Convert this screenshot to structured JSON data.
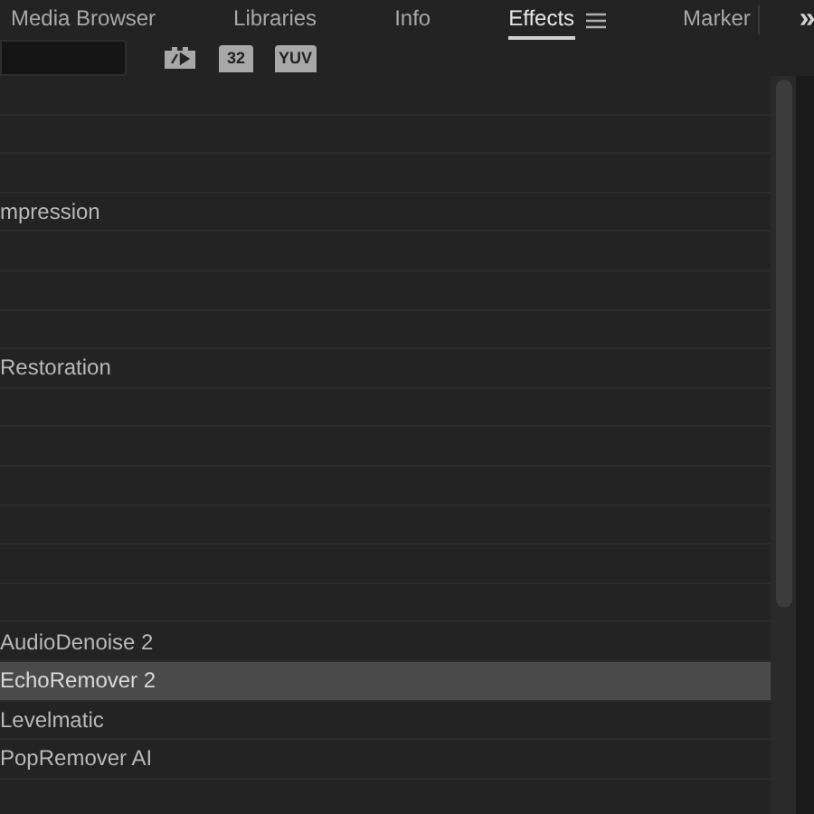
{
  "tabs": [
    {
      "label": "Media Browser",
      "selected": false
    },
    {
      "label": "Libraries",
      "selected": false
    },
    {
      "label": "Info",
      "selected": false
    },
    {
      "label": "Effects",
      "selected": true,
      "menu": true
    },
    {
      "label": "Marker",
      "selected": false
    }
  ],
  "overflow": "»",
  "filters": [
    {
      "kind": "icon"
    },
    {
      "kind": "text",
      "label": "32"
    },
    {
      "kind": "text",
      "label": "YUV"
    }
  ],
  "rows": [
    {
      "selected": false
    },
    {
      "selected": false
    },
    {
      "selected": false
    },
    {
      "label": "mpression",
      "selected": false
    },
    {
      "selected": false
    },
    {
      "selected": false
    },
    {
      "selected": false
    },
    {
      "label": "Restoration",
      "selected": false
    },
    {
      "selected": false
    },
    {
      "selected": false
    },
    {
      "selected": false
    },
    {
      "selected": false
    },
    {
      "selected": false
    },
    {
      "selected": false
    },
    {
      "label": "AudioDenoise 2",
      "selected": false
    },
    {
      "label": "EchoRemover 2",
      "selected": true
    },
    {
      "label": "Levelmatic",
      "selected": false
    },
    {
      "label": "PopRemover AI",
      "selected": false
    },
    {
      "selected": false
    }
  ]
}
